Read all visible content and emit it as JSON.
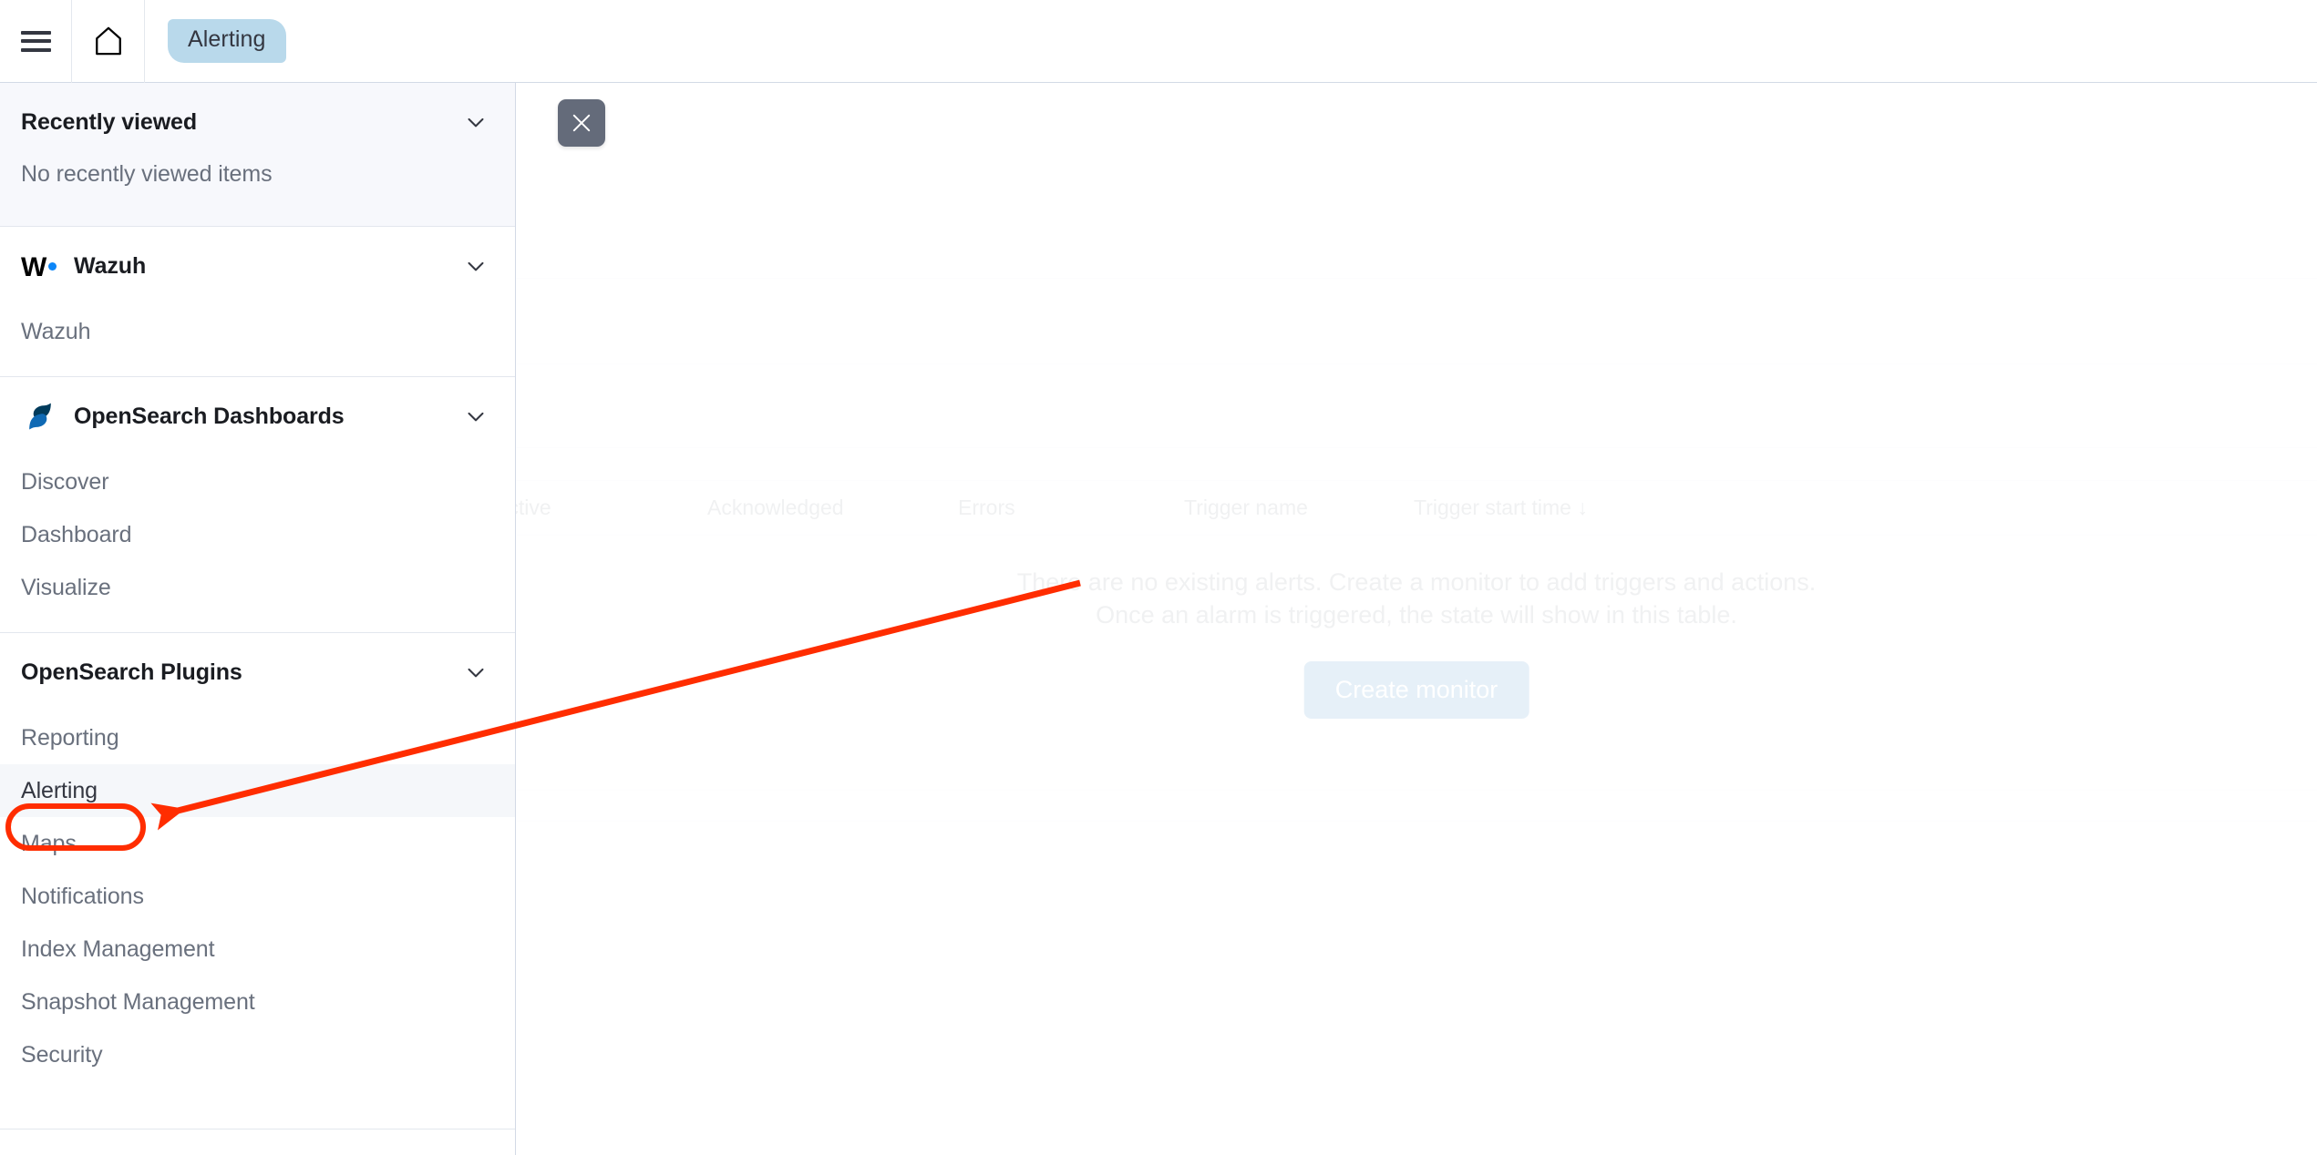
{
  "topbar": {
    "menu_icon": "hamburger-menu-icon",
    "home_icon": "home-icon",
    "breadcrumb": "Alerting"
  },
  "nav": {
    "close_icon": "close-icon",
    "chevron_icon": "chevron-down-icon",
    "sections": [
      {
        "id": "recently-viewed",
        "title": "Recently viewed",
        "empty_text": "No recently viewed items",
        "items": []
      },
      {
        "id": "wazuh",
        "title": "Wazuh",
        "logo": "wazuh-logo",
        "logo_text": "W",
        "items": [
          {
            "label": "Wazuh",
            "selected": false
          }
        ]
      },
      {
        "id": "opensearch-dashboards",
        "title": "OpenSearch Dashboards",
        "logo": "opensearch-logo",
        "items": [
          {
            "label": "Discover",
            "selected": false
          },
          {
            "label": "Dashboard",
            "selected": false
          },
          {
            "label": "Visualize",
            "selected": false
          }
        ]
      },
      {
        "id": "opensearch-plugins",
        "title": "OpenSearch Plugins",
        "items": [
          {
            "label": "Reporting",
            "selected": false
          },
          {
            "label": "Alerting",
            "selected": true
          },
          {
            "label": "Maps",
            "selected": false
          },
          {
            "label": "Notifications",
            "selected": false
          },
          {
            "label": "Index Management",
            "selected": false
          },
          {
            "label": "Snapshot Management",
            "selected": false
          },
          {
            "label": "Security",
            "selected": false
          }
        ]
      }
    ]
  },
  "main": {
    "table": {
      "columns": [
        "Active",
        "Acknowledged",
        "Errors",
        "Trigger name",
        "Trigger start time"
      ],
      "sorted_column": "Trigger start time",
      "sort_icon": "sort-descending-arrow-icon",
      "sort_direction": "↓",
      "rows": []
    },
    "empty_state": {
      "line1": "There are no existing alerts. Create a monitor to add triggers and actions.",
      "line2": "Once an alarm is triggered, the state will show in this table.",
      "action_label": "Create monitor"
    }
  },
  "annotation": {
    "type": "arrow-and-highlight",
    "target": "Alerting",
    "color": "#ff2d00"
  },
  "colors": {
    "breadcrumb_bg": "#b9d9eb",
    "accent_blue": "#006bb4",
    "annotation_red": "#ff2d00",
    "wazuh_dot": "#0d86f8",
    "selected_row_bg": "#f5f7fa",
    "close_button_bg": "#646b7a"
  }
}
